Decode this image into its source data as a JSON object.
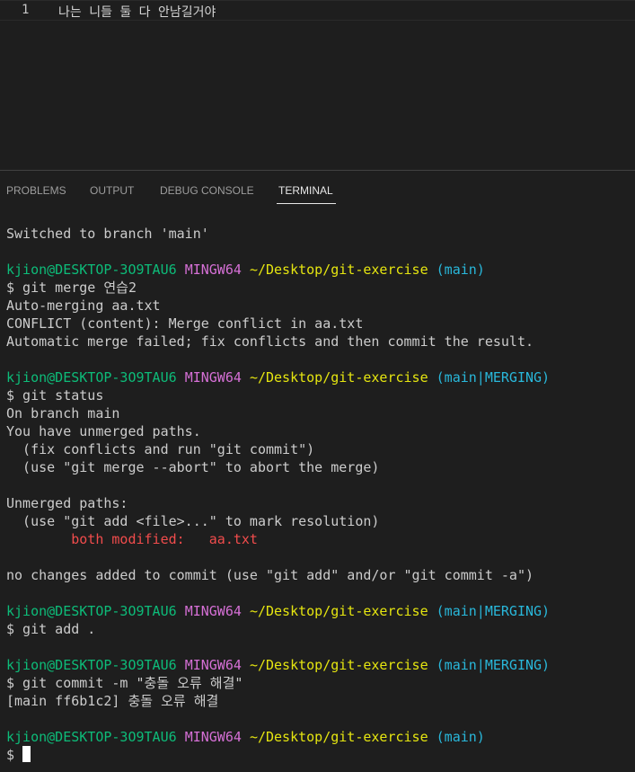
{
  "editor": {
    "line_number": "1",
    "line_text": "나는 니들 둘 다 안남길거야"
  },
  "panel": {
    "tabs": [
      {
        "label": "PROBLEMS"
      },
      {
        "label": "OUTPUT"
      },
      {
        "label": "DEBUG CONSOLE"
      },
      {
        "label": "TERMINAL",
        "active": true
      }
    ]
  },
  "terminal": {
    "prompt": {
      "user_host": "kjion@DESKTOP-3O9TAU6",
      "shell": "MINGW64",
      "path": "~/Desktop/git-exercise",
      "branch_main": "(main)",
      "branch_merging": "(main|MERGING)"
    },
    "lines": {
      "switched": "Switched to branch 'main'",
      "cmd_merge": "$ git merge 연습2",
      "auto_merging": "Auto-merging aa.txt",
      "conflict": "CONFLICT (content): Merge conflict in aa.txt",
      "auto_failed": "Automatic merge failed; fix conflicts and then commit the result.",
      "cmd_status": "$ git status",
      "on_branch": "On branch main",
      "unmerged_paths": "You have unmerged paths.",
      "fix_conflicts": "  (fix conflicts and run \"git commit\")",
      "use_abort": "  (use \"git merge --abort\" to abort the merge)",
      "unmerged_header": "Unmerged paths:",
      "use_add": "  (use \"git add <file>...\" to mark resolution)",
      "both_modified": "        both modified:   aa.txt",
      "no_changes": "no changes added to commit (use \"git add\" and/or \"git commit -a\")",
      "cmd_add": "$ git add .",
      "cmd_commit": "$ git commit -m \"충돌 오류 해결\"",
      "commit_result": "[main ff6b1c2] 충돌 오류 해결",
      "final_prompt": "$ "
    }
  },
  "colors": {
    "background": "#1e1e1e",
    "user": "#0dbc79",
    "shell": "#d670d6",
    "path": "#e5e510",
    "branch": "#29b8db",
    "error": "#f14c4c"
  }
}
